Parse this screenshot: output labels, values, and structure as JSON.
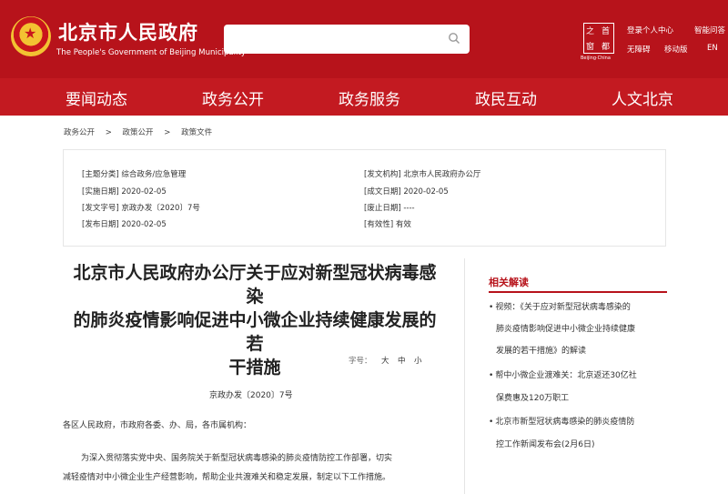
{
  "header": {
    "site_title": "北京市人民政府",
    "site_subtitle": "The People's Government of Beijing Municipality",
    "search_placeholder": "",
    "capital_logo_chars": [
      "之",
      "首",
      "窗",
      "都"
    ],
    "capital_caption": "Beijing·China",
    "links": {
      "login": "登录个人中心",
      "smart_qa": "智能问答",
      "accessibility": "无障碍",
      "mobile": "移动版",
      "language": "EN"
    }
  },
  "nav": [
    "要闻动态",
    "政务公开",
    "政务服务",
    "政民互动",
    "人文北京"
  ],
  "breadcrumb": [
    "政务公开",
    ">",
    "政策公开",
    ">",
    "政策文件"
  ],
  "meta": {
    "topic": "[主题分类] 综合政务/应急管理",
    "issuer": "[发文机构] 北京市人民政府办公厅",
    "effective_date": "[实施日期] 2020-02-05",
    "created_date": "[成文日期] 2020-02-05",
    "doc_number": "[发文字号] 京政办发〔2020〕7号",
    "abolish_date": "[废止日期] ----",
    "publish_date": "[发布日期] 2020-02-05",
    "validity": "[有效性] 有效"
  },
  "article": {
    "title_lines": [
      "北京市人民政府办公厅关于应对新型冠状病毒感染",
      "的肺炎疫情影响促进中小微企业持续健康发展的若",
      "干措施"
    ],
    "font_size_label": "字号：",
    "font_sizes": [
      "大",
      "中",
      "小"
    ],
    "doc_number": "京政办发〔2020〕7号",
    "salutation": "各区人民政府，市政府各委、办、局，各市属机构：",
    "body_lines": [
      "为深入贯彻落实党中央、国务院关于新型冠状病毒感染的肺炎疫情防控工作部署，切实",
      "减轻疫情对中小微企业生产经营影响，帮助企业共渡难关和稳定发展，制定以下工作措施。"
    ]
  },
  "sidebar": {
    "title": "相关解读",
    "items": [
      [
        "视频：《关于应对新型冠状病毒感染的",
        "肺炎疫情影响促进中小微企业持续健康",
        "发展的若干措施》的解读"
      ],
      [
        "帮中小微企业渡难关：北京返还30亿社",
        "保费惠及120万职工"
      ],
      [
        "北京市新型冠状病毒感染的肺炎疫情防",
        "控工作新闻发布会(2月6日)"
      ]
    ]
  },
  "colors": {
    "header_red": "#b7131b",
    "nav_red": "#c31a21",
    "accent_red": "#b7131b"
  }
}
